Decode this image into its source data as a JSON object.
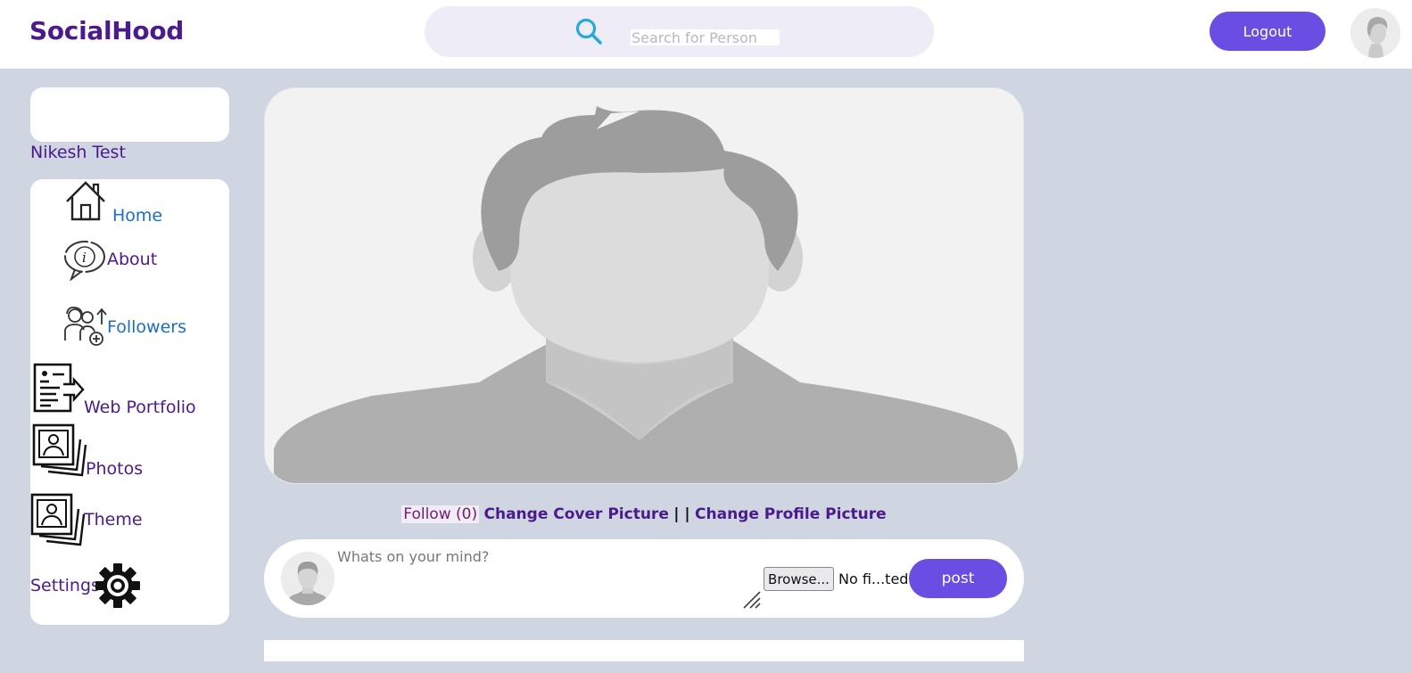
{
  "header": {
    "brand": "SocialHood",
    "search_placeholder": "Search for Person",
    "logout_label": "Logout"
  },
  "profile": {
    "name": "Nikesh Test"
  },
  "sidebar": {
    "items": [
      {
        "label": "Home",
        "icon": "home-icon",
        "color": "#1a6fc4"
      },
      {
        "label": "About",
        "icon": "info-bubble-icon",
        "color": "#4b1a8c"
      },
      {
        "label": "Followers",
        "icon": "followers-icon",
        "color": "#1a6fc4"
      },
      {
        "label": "Web Portfolio",
        "icon": "portfolio-icon",
        "color": "#4b1a8c"
      },
      {
        "label": "Photos",
        "icon": "photos-icon",
        "color": "#4b1a8c"
      },
      {
        "label": "Theme",
        "icon": "theme-icon",
        "color": "#4b1a8c"
      },
      {
        "label": "Settings",
        "icon": "gear-icon",
        "color": "#4b1a8c"
      }
    ]
  },
  "actions": {
    "follow_label": "Follow (0)",
    "change_cover_label": "Change Cover Picture",
    "separator": "| |",
    "change_profile_label": "Change Profile Picture"
  },
  "composer": {
    "placeholder": "Whats on your mind?",
    "browse_label": "Browse...",
    "file_status": "No fi...ted.",
    "post_label": "post"
  },
  "colors": {
    "accent": "#6a4de2",
    "brand": "#4b1a8c",
    "background": "#cfd6e2"
  }
}
